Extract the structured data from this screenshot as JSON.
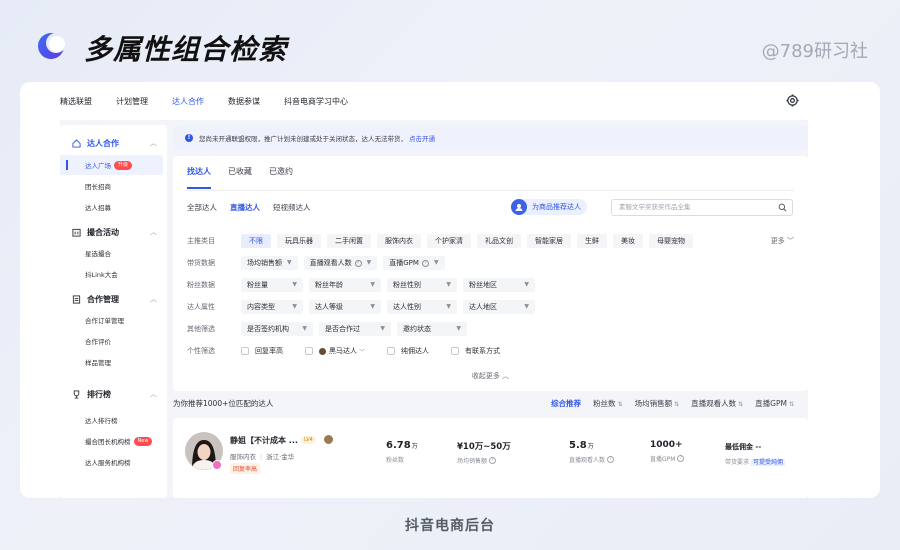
{
  "brand": {
    "title": "多属性组合检索",
    "watermark": "@789研习社",
    "caption": "抖音电商后台"
  },
  "topnav": {
    "items": [
      "精选联盟",
      "计划管理",
      "达人合作",
      "数据参谋",
      "抖音电商学习中心"
    ],
    "active": "达人合作"
  },
  "sidebar": {
    "groups": [
      {
        "title": "达人合作",
        "items": [
          "达人广场",
          "团长招商",
          "达人招募"
        ]
      },
      {
        "title": "撮合活动",
        "items": [
          "星选撮合",
          "抖Link大会"
        ]
      },
      {
        "title": "合作管理",
        "items": [
          "合作订单管理",
          "合作评价",
          "样品管理"
        ]
      },
      {
        "title": "排行榜",
        "items": [
          "达人排行榜",
          "撮合团长机构榜",
          "达人服务机构榜"
        ]
      }
    ],
    "badges": {
      "upgrade": "升级",
      "new": "New"
    }
  },
  "notice": {
    "text": "您尚未开通联盟权限，推广计划未创建或处于关闭状态，达人无法带货，",
    "link": "点击开通"
  },
  "tabs": [
    "找达人",
    "已收藏",
    "已邀约"
  ],
  "subtabs": [
    "全部达人",
    "直播达人",
    "短视频达人"
  ],
  "recommend_label": "为商品推荐达人",
  "search_placeholder": "素服文学奖获奖作品全集",
  "filters": {
    "category": {
      "label": "主推类目",
      "chips": [
        "不限",
        "玩具乐器",
        "二手闲置",
        "服饰内衣",
        "个护家清",
        "礼品文创",
        "智能家居",
        "生鲜",
        "美妆",
        "母婴宠物"
      ],
      "more": "更多"
    },
    "sales": {
      "label": "带货数据",
      "dropdowns": [
        "场均销售额",
        "直播观看人数",
        "直播GPM"
      ]
    },
    "fans": {
      "label": "粉丝数据",
      "dropdowns": [
        "粉丝量",
        "粉丝年龄",
        "粉丝性别",
        "粉丝地区"
      ]
    },
    "attrs": {
      "label": "达人属性",
      "dropdowns": [
        "内容类型",
        "达人等级",
        "达人性别",
        "达人地区"
      ]
    },
    "other": {
      "label": "其他筛选",
      "dropdowns": [
        "是否签约机构",
        "是否合作过",
        "邀约状态"
      ]
    },
    "personal": {
      "label": "个性筛选",
      "checks": [
        "回复率高",
        "黑马达人",
        "纯佣达人",
        "有联系方式"
      ]
    },
    "collapse": "收起更多"
  },
  "results": {
    "title": "为你推荐1000+位匹配的达人",
    "sorts": [
      "综合推荐",
      "粉丝数",
      "场均销售额",
      "直播观看人数",
      "直播GPM"
    ]
  },
  "card": {
    "name": "静姐【不计成本 ...",
    "level": "LV4",
    "category": "服饰内衣",
    "region": "浙江·金华",
    "tag": "回复率高",
    "stats": [
      {
        "value": "6.78",
        "unit": "万",
        "label": "粉丝数"
      },
      {
        "value": "¥10万~50万",
        "unit": "",
        "label": "场均销售额"
      },
      {
        "value": "5.8",
        "unit": "万",
        "label": "直播观看人数"
      },
      {
        "value": "1000+",
        "unit": "",
        "label": "直播GPM"
      }
    ],
    "commission_label": "最低佣金 --",
    "requirement_label": "带货要求",
    "requirement_link": "可提受纯佣"
  },
  "colors": {
    "accent": "#3155e8",
    "danger": "#ff4d4f"
  }
}
